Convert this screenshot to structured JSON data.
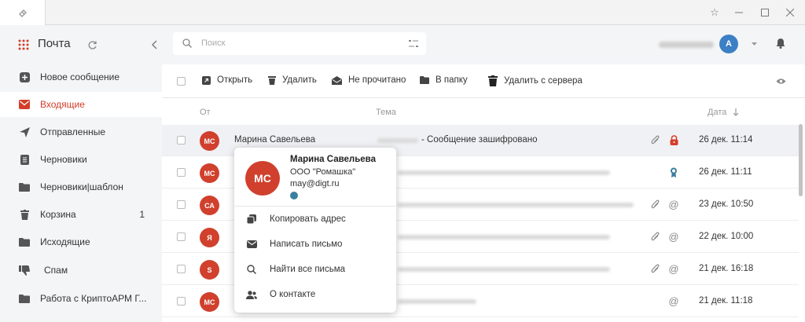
{
  "window": {
    "controls": [
      "star",
      "minimize",
      "maximize",
      "close"
    ]
  },
  "app": {
    "title": "Почта"
  },
  "sidebar": {
    "items": [
      {
        "label": "Новое сообщение",
        "icon": "plus-icon",
        "count": ""
      },
      {
        "label": "Входящие",
        "icon": "inbox-icon",
        "count": "",
        "active": true
      },
      {
        "label": "Отправленные",
        "icon": "send-icon",
        "count": ""
      },
      {
        "label": "Черновики",
        "icon": "draft-icon",
        "count": ""
      },
      {
        "label": "Черновики|шаблон",
        "icon": "folder-icon",
        "count": ""
      },
      {
        "label": "Корзина",
        "icon": "trash-icon",
        "count": "1"
      },
      {
        "label": "Исходящие",
        "icon": "folder-icon",
        "count": ""
      },
      {
        "label": "Спам",
        "icon": "thumbs-down-icon",
        "count": ""
      },
      {
        "label": "Работа с КриптоАРМ Г...",
        "icon": "folder-icon",
        "count": ""
      }
    ]
  },
  "search": {
    "placeholder": "Поиск"
  },
  "user": {
    "avatar_letter": "A"
  },
  "toolbar": {
    "open": "Открыть",
    "delete": "Удалить",
    "unread": "Не прочитано",
    "to_folder": "В папку",
    "delete_server": "Удалить с сервера"
  },
  "columns": {
    "from": "От",
    "subject": "Тема",
    "date": "Дата"
  },
  "messages": [
    {
      "initials": "МС",
      "sender": "Марина Савельева",
      "subject": "- Сообщение зашифровано",
      "date": "26 дек. 11:14",
      "attachment": true,
      "status": "lock"
    },
    {
      "initials": "МС",
      "sender": "",
      "subject": "",
      "date": "26 дек. 11:11",
      "attachment": false,
      "status": "certificate"
    },
    {
      "initials": "СА",
      "sender": "",
      "subject": "",
      "date": "23 дек. 10:50",
      "attachment": true,
      "status": "at"
    },
    {
      "initials": "Я",
      "sender": "",
      "subject": "",
      "date": "22 дек. 10:00",
      "attachment": true,
      "status": "at"
    },
    {
      "initials": "S",
      "sender": "",
      "subject": "",
      "date": "21 дек. 16:18",
      "attachment": true,
      "status": "at"
    },
    {
      "initials": "МС",
      "sender": "",
      "subject": "",
      "date": "21 дек. 11:18",
      "attachment": false,
      "status": "at"
    }
  ],
  "contact_popup": {
    "initials": "МС",
    "name": "Марина Савельева",
    "organization": "ООО \"Ромашка\"",
    "email": "may@digt.ru",
    "actions": [
      {
        "label": "Копировать адрес",
        "icon": "copy-icon"
      },
      {
        "label": "Написать письмо",
        "icon": "envelope-icon"
      },
      {
        "label": "Найти все письма",
        "icon": "search-icon"
      },
      {
        "label": "О контакте",
        "icon": "contact-icon"
      }
    ]
  },
  "colors": {
    "accent": "#d43d2a",
    "avatar_red": "#d0402d",
    "user_avatar_blue": "#3d7fc4",
    "sidebar_bg": "#f4f5f7"
  }
}
